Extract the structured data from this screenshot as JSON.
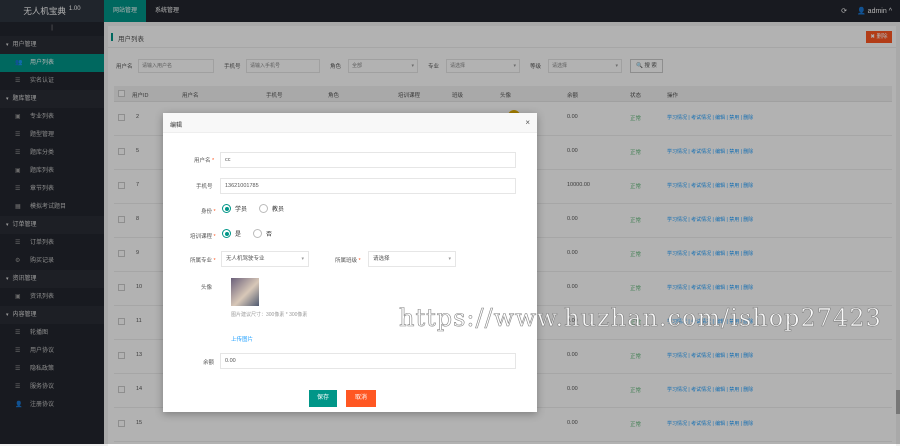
{
  "app": {
    "title": "无人机宝典",
    "version": "1.00"
  },
  "topnav": [
    {
      "label": "网站管理",
      "active": true
    },
    {
      "label": "系统管理",
      "active": false
    }
  ],
  "topright": {
    "refresh_icon": "refresh-icon",
    "user": "admin",
    "user_icon": "user-icon",
    "caret": "^"
  },
  "sidebar": {
    "toggle": "|",
    "groups": [
      {
        "label": "用户管理",
        "items": [
          {
            "label": "用户列表",
            "icon": "users-icon",
            "active": true
          },
          {
            "label": "实名认证",
            "icon": "list-icon",
            "active": false
          }
        ]
      },
      {
        "label": "题库管理",
        "items": [
          {
            "label": "专业列表",
            "icon": "book-icon",
            "active": false
          },
          {
            "label": "题型管理",
            "icon": "list-icon",
            "active": false
          },
          {
            "label": "题库分类",
            "icon": "list-icon",
            "active": false
          },
          {
            "label": "题库列表",
            "icon": "book-icon",
            "active": false
          },
          {
            "label": "章节列表",
            "icon": "list-icon",
            "active": false
          },
          {
            "label": "模拟考试题目",
            "icon": "grid-icon",
            "active": false
          }
        ]
      },
      {
        "label": "订单管理",
        "items": [
          {
            "label": "订单列表",
            "icon": "list-icon",
            "active": false
          },
          {
            "label": "购买记录",
            "icon": "gear-icon",
            "active": false
          }
        ]
      },
      {
        "label": "资讯管理",
        "items": [
          {
            "label": "资讯列表",
            "icon": "book-icon",
            "active": false
          }
        ]
      },
      {
        "label": "内容管理",
        "items": [
          {
            "label": "轮播图",
            "icon": "list-icon",
            "active": false
          },
          {
            "label": "用户协议",
            "icon": "list-icon",
            "active": false
          },
          {
            "label": "隐私政策",
            "icon": "list-icon",
            "active": false
          },
          {
            "label": "服务协议",
            "icon": "list-icon",
            "active": false
          },
          {
            "label": "注册协议",
            "icon": "user-icon",
            "active": false
          }
        ]
      }
    ]
  },
  "page": {
    "title": "用户列表",
    "delete_label": "✖ 删除",
    "filters": {
      "username_label": "用户名",
      "username_placeholder": "请输入用户名",
      "phone_label": "手机号",
      "phone_placeholder": "请输入手机号",
      "role_label": "角色",
      "role_value": "全部",
      "major_label": "专业",
      "major_value": "请选择",
      "grade_label": "等级",
      "grade_value": "请选择",
      "search_label": "搜 索"
    },
    "columns": [
      "用户ID",
      "用户名",
      "手机号",
      "角色",
      "培训课程",
      "班级",
      "头像",
      "余额",
      "状态",
      "操作"
    ],
    "rows": [
      {
        "id": "2",
        "username": "",
        "balance": "0.00",
        "status": "正常",
        "ops": "学习情况 | 考试情况 | 编辑 | 禁用 | 删除"
      },
      {
        "id": "5",
        "username": "",
        "balance": "0.00",
        "status": "正常",
        "ops": "学习情况 | 考试情况 | 编辑 | 禁用 | 删除"
      },
      {
        "id": "7",
        "username": "",
        "balance": "10000.00",
        "status": "正常",
        "ops": "学习情况 | 考试情况 | 编辑 | 禁用 | 删除"
      },
      {
        "id": "8",
        "username": "",
        "balance": "0.00",
        "status": "正常",
        "ops": "学习情况 | 考试情况 | 编辑 | 禁用 | 删除"
      },
      {
        "id": "9",
        "username": "",
        "balance": "0.00",
        "status": "正常",
        "ops": "学习情况 | 考试情况 | 编辑 | 禁用 | 删除"
      },
      {
        "id": "10",
        "username": "",
        "balance": "0.00",
        "status": "正常",
        "ops": "学习情况 | 考试情况 | 编辑 | 禁用 | 删除"
      },
      {
        "id": "11",
        "username": "",
        "balance": "0.00",
        "status": "正常",
        "ops": "学习情况 | 考试情况 | 编辑 | 禁用 | 删除"
      },
      {
        "id": "13",
        "username": "",
        "balance": "0.00",
        "status": "正常",
        "ops": "学习情况 | 考试情况 | 编辑 | 禁用 | 删除"
      },
      {
        "id": "14",
        "username": "",
        "balance": "0.00",
        "status": "正常",
        "ops": "学习情况 | 考试情况 | 编辑 | 禁用 | 删除"
      },
      {
        "id": "15",
        "username": "",
        "balance": "0.00",
        "status": "正常",
        "ops": "学习情况 | 考试情况 | 编辑 | 禁用 | 删除"
      }
    ]
  },
  "modal": {
    "title": "编辑",
    "close": "×",
    "username_label": "用户名",
    "username_value": "cc",
    "phone_label": "手机号",
    "phone_value": "13621001785",
    "role_label": "身份",
    "role_options": [
      "学员",
      "教员"
    ],
    "role_selected": "学员",
    "train_label": "培训课程",
    "train_options": [
      "是",
      "否"
    ],
    "train_selected": "是",
    "major_label": "所属专业",
    "major_value": "无人机驾驶专业",
    "class_label": "所属班级",
    "class_value": "请选择",
    "avatar_label": "头像",
    "avatar_hint": "图片建议尺寸：300像素 * 300像素",
    "upload_label": "上传图片",
    "balance_label": "余额",
    "balance_value": "0.00",
    "save_label": "保存",
    "cancel_label": "取消",
    "required_mark": "*"
  },
  "watermark": "https://www.huzhan.com/ishop27423"
}
